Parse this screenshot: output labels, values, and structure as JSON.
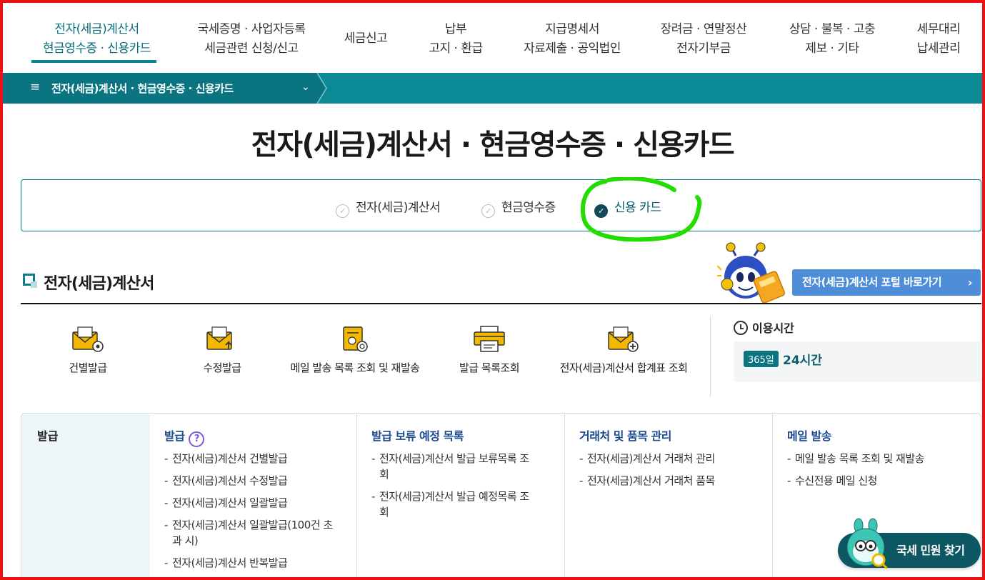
{
  "nav": {
    "items": [
      {
        "line1": "전자(세금)계산서",
        "line2": "현금영수증 · 신용카드"
      },
      {
        "line1": "국세증명 · 사업자등록",
        "line2": "세금관련 신청/신고"
      },
      {
        "line1": "세금신고",
        "line2": ""
      },
      {
        "line1": "납부",
        "line2": "고지 · 환급"
      },
      {
        "line1": "지급명세서",
        "line2": "자료제출 · 공익법인"
      },
      {
        "line1": "장려금 · 연말정산",
        "line2": "전자기부금"
      },
      {
        "line1": "상담 · 불복 · 고충",
        "line2": "제보 · 기타"
      },
      {
        "line1": "세무대리",
        "line2": "납세관리"
      }
    ]
  },
  "subbar": {
    "label": "전자(세금)계산서 · 현금영수증 · 신용카드",
    "menu_glyph": "≡",
    "chevron_glyph": "⌄"
  },
  "page_title": "전자(세금)계산서 · 현금영수증 · 신용카드",
  "tabs": [
    {
      "label": "전자(세금)계산서",
      "selected": false
    },
    {
      "label": "현금영수증",
      "selected": false
    },
    {
      "label": "신용 카드",
      "selected": true
    }
  ],
  "section": {
    "title": "전자(세금)계산서",
    "portal_button": "전자(세금)계산서 포털 바로가기"
  },
  "quick_icons": [
    {
      "label": "건별발급",
      "icon": "envelope-gear-icon"
    },
    {
      "label": "수정발급",
      "icon": "envelope-edit-icon"
    },
    {
      "label": "메일 발송 목록 조회 및 재발송",
      "icon": "mail-scroll-icon"
    },
    {
      "label": "발급 목록조회",
      "icon": "printer-icon"
    },
    {
      "label": "전자(세금)계산서 합계표 조회",
      "icon": "envelope-plus-icon"
    }
  ],
  "hours": {
    "title": "이용시간",
    "badge": "365일",
    "value": "24시간"
  },
  "menu": {
    "category": "발급",
    "columns": [
      {
        "title": "발급",
        "help": "?",
        "items": [
          "전자(세금)계산서 건별발급",
          "전자(세금)계산서 수정발급",
          "전자(세금)계산서 일괄발급",
          "전자(세금)계산서 일괄발급(100건 초과 시)",
          "전자(세금)계산서 반복발급"
        ]
      },
      {
        "title": "발급 보류 예정 목록",
        "items": [
          "전자(세금)계산서 발급 보류목록 조회",
          "전자(세금)계산서 발급 예정목록 조회"
        ]
      },
      {
        "title": "거래처 및 품목 관리",
        "items": [
          "전자(세금)계산서 거래처 관리",
          "전자(세금)계산서 거래처 품목"
        ]
      },
      {
        "title": "메일 발송",
        "items": [
          "메일 발송 목록 조회 및 재발송",
          "수신전용 메일 신청"
        ]
      }
    ]
  },
  "find_button": "국세 민원 찾기",
  "colors": {
    "teal": "#0b8a96",
    "teal_dark": "#0a7480",
    "portal_blue": "#4e8ed8",
    "highlight_green": "#22dd00",
    "frame_red": "#ee1111"
  }
}
